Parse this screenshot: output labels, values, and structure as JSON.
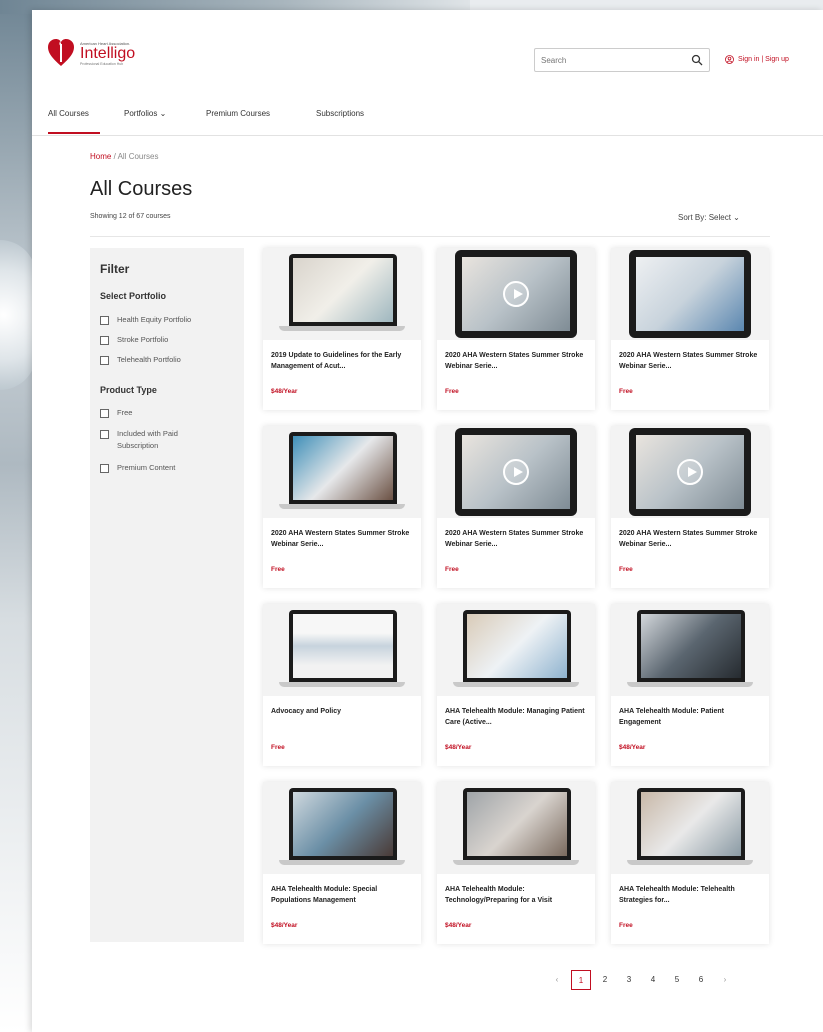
{
  "brand": {
    "org": "American Heart Association.",
    "name": "Intelligo",
    "tagline": "Professional Education Hub"
  },
  "header": {
    "search_placeholder": "Search",
    "signin_label": "Sign in | Sign up"
  },
  "nav": {
    "tabs": [
      {
        "label": "All Courses"
      },
      {
        "label": "Portfolios ⌄"
      },
      {
        "label": "Premium Courses"
      },
      {
        "label": "Subscriptions"
      }
    ]
  },
  "breadcrumb": {
    "home": "Home",
    "separator": " / ",
    "current": "All Courses"
  },
  "page": {
    "title": "All Courses",
    "showing": "Showing 12 of 67 courses",
    "sort_label": "Sort By:",
    "sort_value": "Select ⌄"
  },
  "filter": {
    "heading": "Filter",
    "portfolio_heading": "Select Portfolio",
    "portfolios": [
      "Health Equity Portfolio",
      "Stroke Portfolio",
      "Telehealth Portfolio"
    ],
    "type_heading": "Product Type",
    "types": [
      "Free",
      "Included with Paid Subscription",
      "Premium Content"
    ]
  },
  "courses": [
    {
      "title": "2019 Update to Guidelines for the Early Management of Acut...",
      "price": "$48/Year"
    },
    {
      "title": "2020 AHA Western States Summer Stroke Webinar Serie...",
      "price": "Free"
    },
    {
      "title": "2020 AHA Western States Summer Stroke Webinar Serie...",
      "price": "Free"
    },
    {
      "title": "2020 AHA Western States Summer Stroke Webinar Serie...",
      "price": "Free"
    },
    {
      "title": "2020 AHA Western States Summer Stroke Webinar Serie...",
      "price": "Free"
    },
    {
      "title": "2020 AHA Western States Summer Stroke Webinar Serie...",
      "price": "Free"
    },
    {
      "title": "Advocacy and Policy",
      "price": "Free"
    },
    {
      "title": "AHA Telehealth Module: Managing Patient Care (Active...",
      "price": "$48/Year"
    },
    {
      "title": "AHA Telehealth Module: Patient Engagement",
      "price": "$48/Year"
    },
    {
      "title": "AHA Telehealth Module: Special Populations Management",
      "price": "$48/Year"
    },
    {
      "title": "AHA Telehealth Module: Technology/Preparing for a Visit",
      "price": "$48/Year"
    },
    {
      "title": "AHA Telehealth Module: Telehealth Strategies for...",
      "price": "Free"
    }
  ],
  "pagination": {
    "prev": "‹",
    "pages": [
      "1",
      "2",
      "3",
      "4",
      "5",
      "6"
    ],
    "current": "1",
    "next": "›"
  },
  "colors": {
    "accent": "#c10e21"
  }
}
